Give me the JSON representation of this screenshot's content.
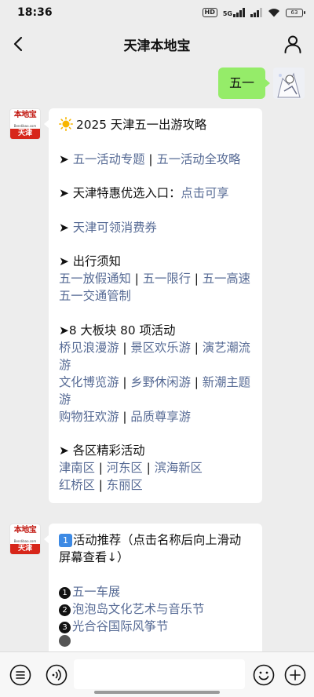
{
  "status": {
    "time": "18:36",
    "hd": "HD",
    "network": "5G",
    "battery": "63"
  },
  "nav": {
    "title": "天津本地宝",
    "back_icon": "chevron-left-icon",
    "profile_icon": "user-profile-icon"
  },
  "chat": {
    "user_message": "五一",
    "bot_avatar": {
      "top": "本地宝",
      "mid": "Bendibao.com",
      "bottom": "天津"
    },
    "message1": {
      "title": "2025 天津五一出游攻略",
      "arrow": "➤",
      "s1": {
        "a": "五一活动专题",
        "sep": " | ",
        "b": "五一活动全攻略"
      },
      "s2": {
        "text": "天津特惠优选入口：",
        "link": "点击可享"
      },
      "s3": {
        "link": "天津可领消费券"
      },
      "s4": {
        "heading": "出行须知",
        "a": "五一放假通知",
        "b": "五一限行",
        "c": "五一高速",
        "d": "五一交通管制"
      },
      "s5": {
        "heading": "8 大板块 80 项活动",
        "items": [
          "桥见浪漫游",
          "景区欢乐游",
          "演艺潮流游",
          "文化博览游",
          "乡野休闲游",
          "新潮主题游",
          "购物狂欢游",
          "品质尊享游"
        ]
      },
      "s6": {
        "heading": "各区精彩活动",
        "items": [
          "津南区",
          "河东区",
          "滨海新区",
          "红桥区",
          "东丽区"
        ]
      }
    },
    "message2": {
      "keycap": "1",
      "header": "活动推荐（点击名称后向上滑动屏幕查看↓）",
      "items": [
        {
          "num": "1",
          "label": "五一车展"
        },
        {
          "num": "2",
          "label": "泡泡岛文化艺术与音乐节"
        },
        {
          "num": "3",
          "label": "光合谷国际风筝节"
        }
      ]
    }
  },
  "input_bar": {
    "left_icon": "list-menu-icon",
    "voice_icon": "voice-icon",
    "emoji_icon": "emoji-icon",
    "add_icon": "add-icon"
  },
  "colors": {
    "link": "#576b95",
    "bubble_out": "#95ec69",
    "background": "#ededed",
    "brand_red": "#d7261a"
  }
}
